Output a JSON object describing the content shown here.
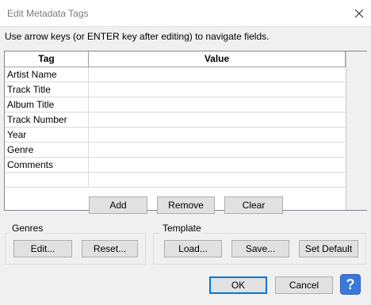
{
  "window": {
    "title": "Edit Metadata Tags",
    "close_icon": "close-icon"
  },
  "instructions": "Use arrow keys (or ENTER key after editing) to navigate fields.",
  "grid": {
    "columns": [
      "Tag",
      "Value"
    ],
    "rows": [
      {
        "tag": "Artist Name",
        "value": ""
      },
      {
        "tag": "Track Title",
        "value": ""
      },
      {
        "tag": "Album Title",
        "value": ""
      },
      {
        "tag": "Track Number",
        "value": ""
      },
      {
        "tag": "Year",
        "value": ""
      },
      {
        "tag": "Genre",
        "value": ""
      },
      {
        "tag": "Comments",
        "value": ""
      },
      {
        "tag": "",
        "value": ""
      }
    ]
  },
  "grid_buttons": {
    "add": "Add",
    "remove": "Remove",
    "clear": "Clear"
  },
  "genres": {
    "label": "Genres",
    "edit": "Edit...",
    "reset": "Reset..."
  },
  "template": {
    "label": "Template",
    "load": "Load...",
    "save": "Save...",
    "set_default": "Set Default"
  },
  "footer": {
    "ok": "OK",
    "cancel": "Cancel",
    "help": "?"
  },
  "colors": {
    "accent": "#0078d7",
    "help_bg": "#3b78d8"
  }
}
